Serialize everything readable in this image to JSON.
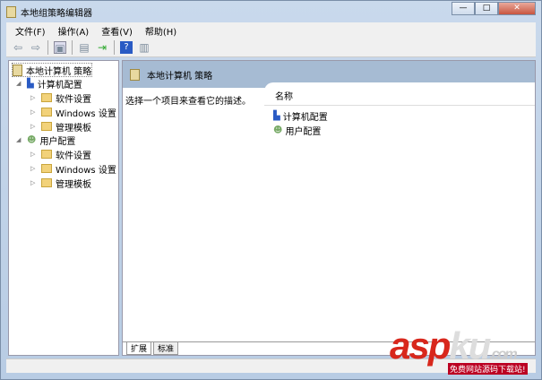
{
  "window": {
    "title": "本地组策略编辑器",
    "buttons": [
      "—",
      "□",
      "✕"
    ]
  },
  "menu": [
    "文件(F)",
    "操作(A)",
    "查看(V)",
    "帮助(H)"
  ],
  "toolbar": [
    "back",
    "forward",
    "show-hide-tree",
    "properties",
    "export",
    "help",
    "show-hide-action"
  ],
  "tree": {
    "root": "本地计算机 策略",
    "nodes": [
      {
        "label": "计算机配置",
        "children": [
          "软件设置",
          "Windows 设置",
          "管理模板"
        ]
      },
      {
        "label": "用户配置",
        "children": [
          "软件设置",
          "Windows 设置",
          "管理模板"
        ]
      }
    ]
  },
  "pane": {
    "header": "本地计算机 策略",
    "description": "选择一个项目来查看它的描述。",
    "column": "名称",
    "items": [
      "计算机配置",
      "用户配置"
    ],
    "tabs": [
      "扩展",
      "标准"
    ]
  },
  "watermark": {
    "logo": "aspku",
    "suffix": ".com",
    "slogan": "免费网站源码下载站!"
  }
}
